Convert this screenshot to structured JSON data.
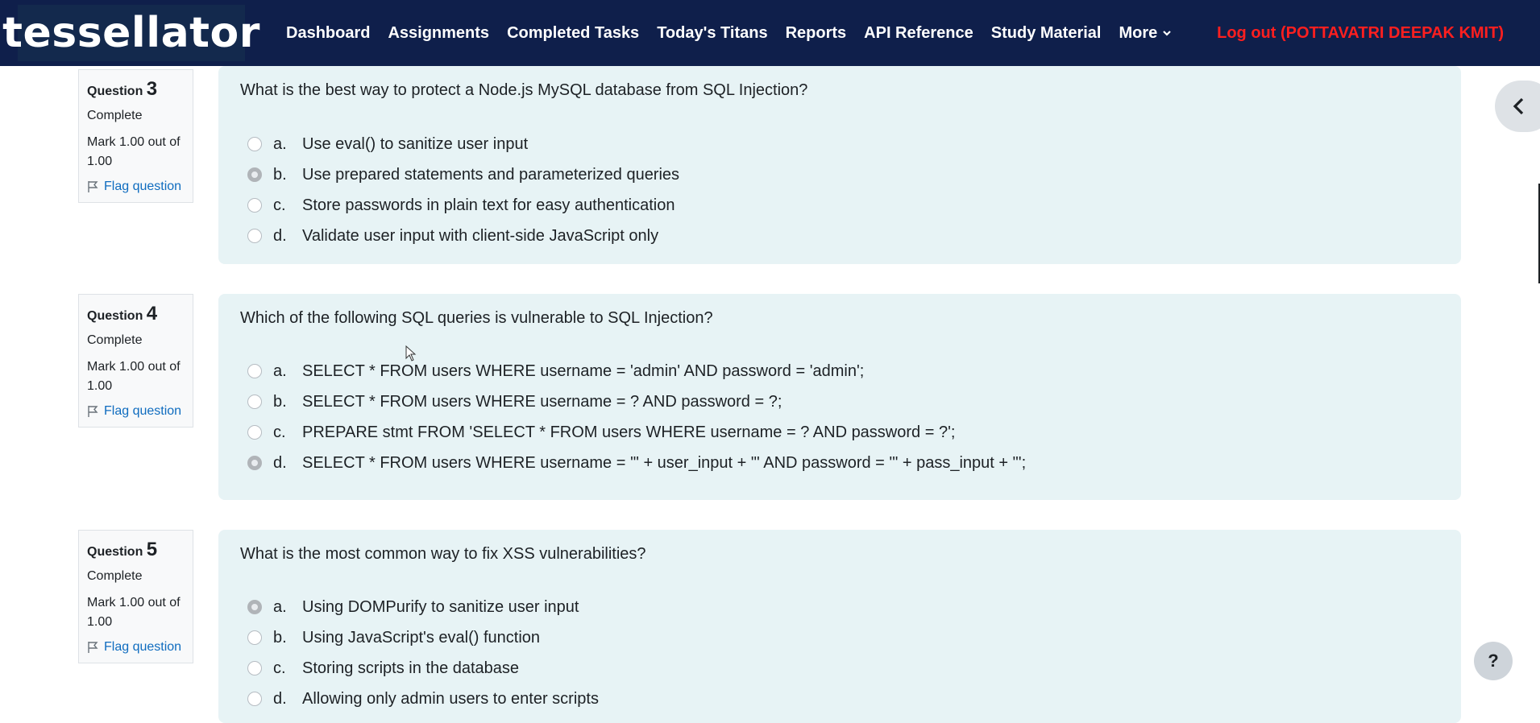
{
  "brand": "tessellator",
  "nav": {
    "items": [
      "Dashboard",
      "Assignments",
      "Completed Tasks",
      "Today's Titans",
      "Reports",
      "API Reference",
      "Study Material",
      "More"
    ],
    "logout": "Log out (POTTAVATRI DEEPAK KMIT)"
  },
  "questions": [
    {
      "label": "Question",
      "number": "3",
      "state": "Complete",
      "grade": "Mark 1.00 out of 1.00",
      "flag": "Flag question",
      "text": "What is the best way to protect a Node.js MySQL database from SQL Injection?",
      "answers": [
        {
          "letter": "a.",
          "text": "Use eval() to sanitize user input"
        },
        {
          "letter": "b.",
          "text": "Use prepared statements and parameterized queries"
        },
        {
          "letter": "c.",
          "text": "Store passwords in plain text for easy authentication"
        },
        {
          "letter": "d.",
          "text": "Validate user input with client-side JavaScript only"
        }
      ],
      "selected": "b."
    },
    {
      "label": "Question",
      "number": "4",
      "state": "Complete",
      "grade": "Mark 1.00 out of 1.00",
      "flag": "Flag question",
      "text": "Which of the following SQL queries is vulnerable to SQL Injection?",
      "answers": [
        {
          "letter": "a.",
          "text": "SELECT * FROM users WHERE username = 'admin' AND password = 'admin';"
        },
        {
          "letter": "b.",
          "text": "SELECT * FROM users WHERE username = ? AND password = ?;"
        },
        {
          "letter": "c.",
          "text": "PREPARE stmt FROM 'SELECT * FROM users WHERE username = ? AND password = ?';"
        },
        {
          "letter": "d.",
          "text": "SELECT * FROM users WHERE username = '\" + user_input + \"' AND password = '\" + pass_input + \"';"
        }
      ],
      "selected": "d."
    },
    {
      "label": "Question",
      "number": "5",
      "state": "Complete",
      "grade": "Mark 1.00 out of 1.00",
      "flag": "Flag question",
      "text": "What is the most common way to fix XSS vulnerabilities?",
      "answers": [
        {
          "letter": "a.",
          "text": "Using DOMPurify to sanitize user input"
        },
        {
          "letter": "b.",
          "text": "Using JavaScript's eval() function"
        },
        {
          "letter": "c.",
          "text": "Storing scripts in the database"
        },
        {
          "letter": "d.",
          "text": "Allowing only admin users to enter scripts"
        }
      ],
      "selected": "a."
    }
  ],
  "icons": {
    "flag": "flag-icon",
    "drawer": "chevron-left-icon",
    "help": "question-mark-icon",
    "more": "chevron-down-icon"
  },
  "help_label": "?",
  "drawer_label": "‹",
  "colors": {
    "navbar": "#0f1f4b",
    "logout": "#ff1f1f",
    "link": "#0f6cbf",
    "formulation_bg": "#e7f3f5"
  }
}
